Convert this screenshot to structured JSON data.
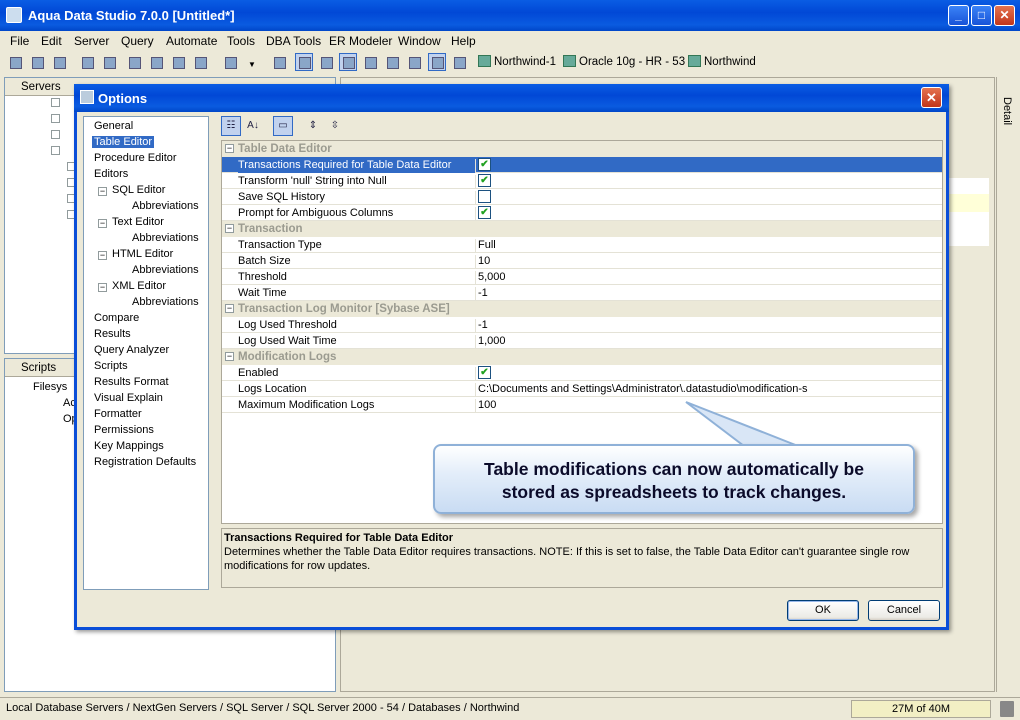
{
  "window": {
    "title": "Aqua Data Studio 7.0.0 [Untitled*]",
    "min": "_",
    "max": "□",
    "close": "✕"
  },
  "menubar": [
    "File",
    "Edit",
    "Server",
    "Query",
    "Automate",
    "Tools",
    "DBA Tools",
    "ER Modeler",
    "Window",
    "Help"
  ],
  "toolbar": {
    "connections": [
      "Northwind-1",
      "Oracle 10g - HR - 53",
      "Northwind"
    ]
  },
  "left_panels": {
    "servers_title": "Servers",
    "scripts_title": "Scripts",
    "scripts_items": [
      "Filesys",
      "Ac",
      "Op"
    ]
  },
  "right_panel": {
    "detail_label": "Detail"
  },
  "statusbar": {
    "path": "Local Database Servers / NextGen Servers / SQL Server / SQL Server 2000 - 54 / Databases / Northwind",
    "memory": "27M of 40M"
  },
  "dialog": {
    "title": "Options",
    "close": "✕",
    "nav": [
      {
        "label": "General",
        "indent": 0
      },
      {
        "label": "Table Editor",
        "indent": 0,
        "selected": true
      },
      {
        "label": "Procedure Editor",
        "indent": 0
      },
      {
        "label": "Editors",
        "indent": 0
      },
      {
        "label": "SQL Editor",
        "indent": 1,
        "exp": "−"
      },
      {
        "label": "Abbreviations",
        "indent": 2
      },
      {
        "label": "Text Editor",
        "indent": 1,
        "exp": "−"
      },
      {
        "label": "Abbreviations",
        "indent": 2
      },
      {
        "label": "HTML Editor",
        "indent": 1,
        "exp": "−"
      },
      {
        "label": "Abbreviations",
        "indent": 2
      },
      {
        "label": "XML Editor",
        "indent": 1,
        "exp": "−"
      },
      {
        "label": "Abbreviations",
        "indent": 2
      },
      {
        "label": "Compare",
        "indent": 0
      },
      {
        "label": "Results",
        "indent": 0
      },
      {
        "label": "Query Analyzer",
        "indent": 0
      },
      {
        "label": "Scripts",
        "indent": 0
      },
      {
        "label": "Results Format",
        "indent": 0
      },
      {
        "label": "Visual Explain",
        "indent": 0
      },
      {
        "label": "Formatter",
        "indent": 0
      },
      {
        "label": "Permissions",
        "indent": 0
      },
      {
        "label": "Key Mappings",
        "indent": 0
      },
      {
        "label": "Registration Defaults",
        "indent": 0
      }
    ],
    "categories": [
      {
        "name": "Table Data Editor",
        "props": [
          {
            "label": "Transactions Required for Table Data Editor",
            "type": "check",
            "checked": true,
            "selected": true
          },
          {
            "label": "Transform 'null' String into Null",
            "type": "check",
            "checked": true
          },
          {
            "label": "Save SQL History",
            "type": "check",
            "checked": false
          },
          {
            "label": "Prompt for Ambiguous Columns",
            "type": "check",
            "checked": true
          }
        ]
      },
      {
        "name": "Transaction",
        "props": [
          {
            "label": "Transaction Type",
            "value": "Full"
          },
          {
            "label": "Batch Size",
            "value": "10"
          },
          {
            "label": "Threshold",
            "value": "5,000"
          },
          {
            "label": "Wait Time",
            "value": "-1"
          }
        ]
      },
      {
        "name": "Transaction Log Monitor [Sybase ASE]",
        "props": [
          {
            "label": "Log Used Threshold",
            "value": "-1"
          },
          {
            "label": "Log Used Wait Time",
            "value": "1,000"
          }
        ]
      },
      {
        "name": "Modification Logs",
        "props": [
          {
            "label": "Enabled",
            "type": "check",
            "checked": true
          },
          {
            "label": "Logs Location",
            "value": "C:\\Documents and Settings\\Administrator\\.datastudio\\modification-s"
          },
          {
            "label": "Maximum Modification Logs",
            "value": "100"
          }
        ]
      }
    ],
    "description": {
      "title": "Transactions Required for Table Data Editor",
      "text": "Determines whether the Table Data Editor requires transactions. NOTE: If this is set to false, the Table Data Editor can't guarantee single row modifications for row updates."
    },
    "ok_label": "OK",
    "cancel_label": "Cancel"
  },
  "callout": {
    "line1": "Table modifications can now automatically be",
    "line2": "stored as spreadsheets to track changes."
  }
}
